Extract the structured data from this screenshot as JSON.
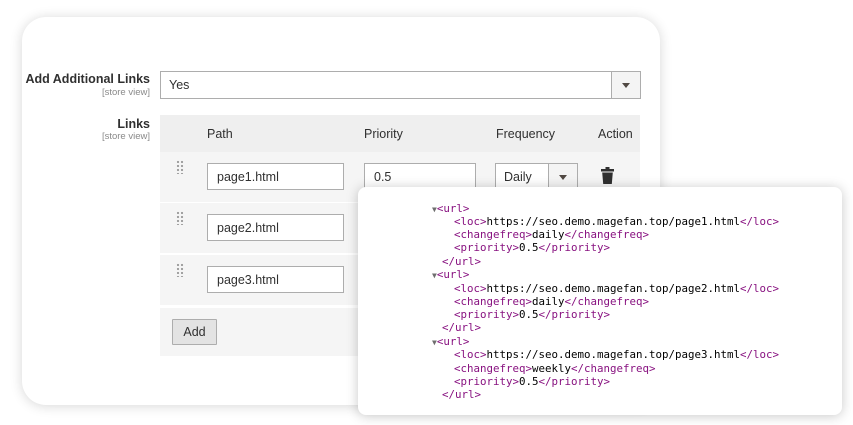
{
  "field_additional": {
    "label": "Add Additional Links",
    "scope": "[store view]",
    "value": "Yes"
  },
  "field_links": {
    "label": "Links",
    "scope": "[store view]"
  },
  "grid": {
    "headers": {
      "path": "Path",
      "priority": "Priority",
      "frequency": "Frequency",
      "action": "Action"
    },
    "rows": [
      {
        "path": "page1.html",
        "priority": "0.5",
        "frequency": "Daily"
      },
      {
        "path": "page2.html"
      },
      {
        "path": "page3.html"
      }
    ],
    "add_label": "Add"
  },
  "xml": {
    "entries": [
      {
        "loc": "https://seo.demo.magefan.top/page1.html",
        "changefreq": "daily",
        "priority": "0.5"
      },
      {
        "loc": "https://seo.demo.magefan.top/page2.html",
        "changefreq": "daily",
        "priority": "0.5"
      },
      {
        "loc": "https://seo.demo.magefan.top/page3.html",
        "changefreq": "weekly",
        "priority": "0.5"
      }
    ]
  },
  "icons": {
    "handle": "drag-handle-icon",
    "delete": "trash-icon",
    "dropdown": "chevron-down-icon",
    "expand": "triangle-down-icon"
  },
  "colors": {
    "xml_tag": "#881280"
  }
}
